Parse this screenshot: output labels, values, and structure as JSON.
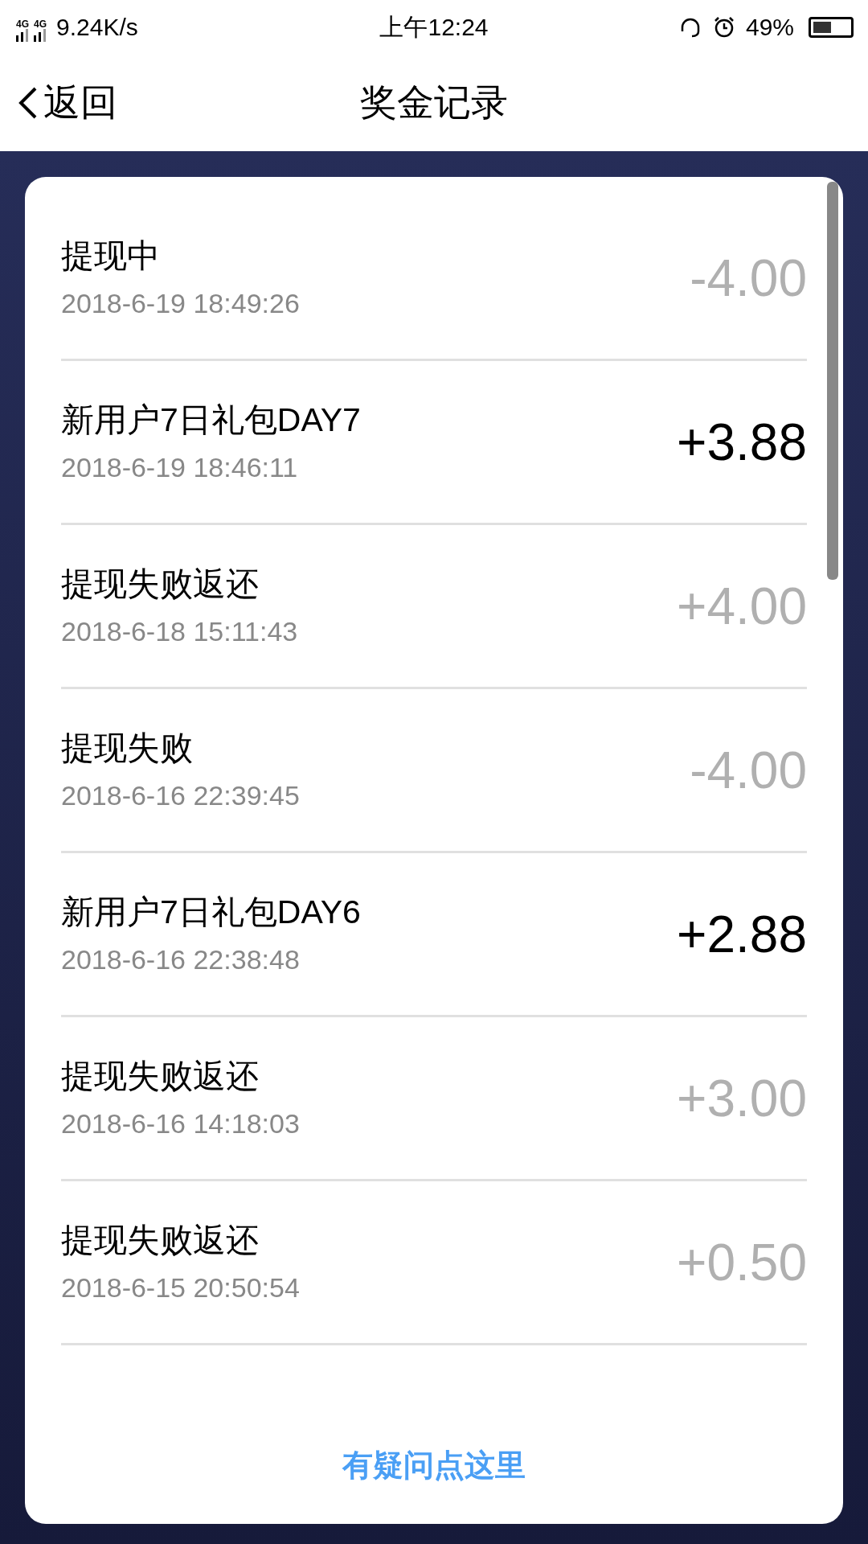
{
  "status_bar": {
    "network_labels": [
      "4G",
      "4G"
    ],
    "speed": "9.24K/s",
    "time": "上午12:24",
    "battery": "49%"
  },
  "header": {
    "back": "返回",
    "title": "奖金记录"
  },
  "records": [
    {
      "title": "提现中",
      "time": "2018-6-19 18:49:26",
      "amount": "-4.00",
      "highlighted": false
    },
    {
      "title": "新用户7日礼包DAY7",
      "time": "2018-6-19 18:46:11",
      "amount": "+3.88",
      "highlighted": true
    },
    {
      "title": "提现失败返还",
      "time": "2018-6-18 15:11:43",
      "amount": "+4.00",
      "highlighted": false
    },
    {
      "title": "提现失败",
      "time": "2018-6-16 22:39:45",
      "amount": "-4.00",
      "highlighted": false
    },
    {
      "title": "新用户7日礼包DAY6",
      "time": "2018-6-16 22:38:48",
      "amount": "+2.88",
      "highlighted": true
    },
    {
      "title": "提现失败返还",
      "time": "2018-6-16 14:18:03",
      "amount": "+3.00",
      "highlighted": false
    },
    {
      "title": "提现失败返还",
      "time": "2018-6-15 20:50:54",
      "amount": "+0.50",
      "highlighted": false
    }
  ],
  "help_link": "有疑问点这里"
}
